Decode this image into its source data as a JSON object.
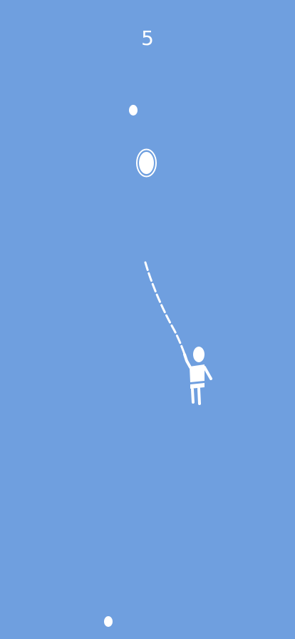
{
  "game": {
    "score": "5",
    "background_color": "#6f9fdf",
    "foreground_color": "#ffffff"
  }
}
